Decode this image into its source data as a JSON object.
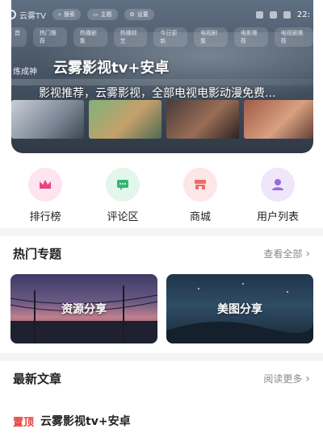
{
  "banner": {
    "logo_text": "云雾TV",
    "pills": [
      "搜索",
      "主题",
      "设置"
    ],
    "clock": "22:",
    "categories": [
      "首",
      "热门推荐",
      "热播剧集",
      "热播综艺",
      "今日更新",
      "电视剧集",
      "电影推荐",
      "电视剧推荐"
    ],
    "side_label": "炼成神",
    "title": "云雾影视tv+安卓",
    "subtitle": "影视推荐，云雾影视，全部电视电影动漫免费..."
  },
  "quick_links": [
    {
      "label": "排行榜",
      "icon": "crown-icon",
      "bg": "#fde4ef",
      "fg": "#e8457f"
    },
    {
      "label": "评论区",
      "icon": "comment-icon",
      "bg": "#e2f6ec",
      "fg": "#33b66f"
    },
    {
      "label": "商城",
      "icon": "store-icon",
      "bg": "#fde6e6",
      "fg": "#ef6b6b"
    },
    {
      "label": "用户列表",
      "icon": "user-icon",
      "bg": "#efe6fb",
      "fg": "#9b6bdc"
    }
  ],
  "topics_section": {
    "title": "热门专题",
    "more": "查看全部",
    "items": [
      "资源分享",
      "美图分享"
    ]
  },
  "articles_section": {
    "title": "最新文章",
    "more": "阅读更多",
    "pinned_tag": "置顶",
    "first_title": "云雾影视tv+安卓"
  }
}
